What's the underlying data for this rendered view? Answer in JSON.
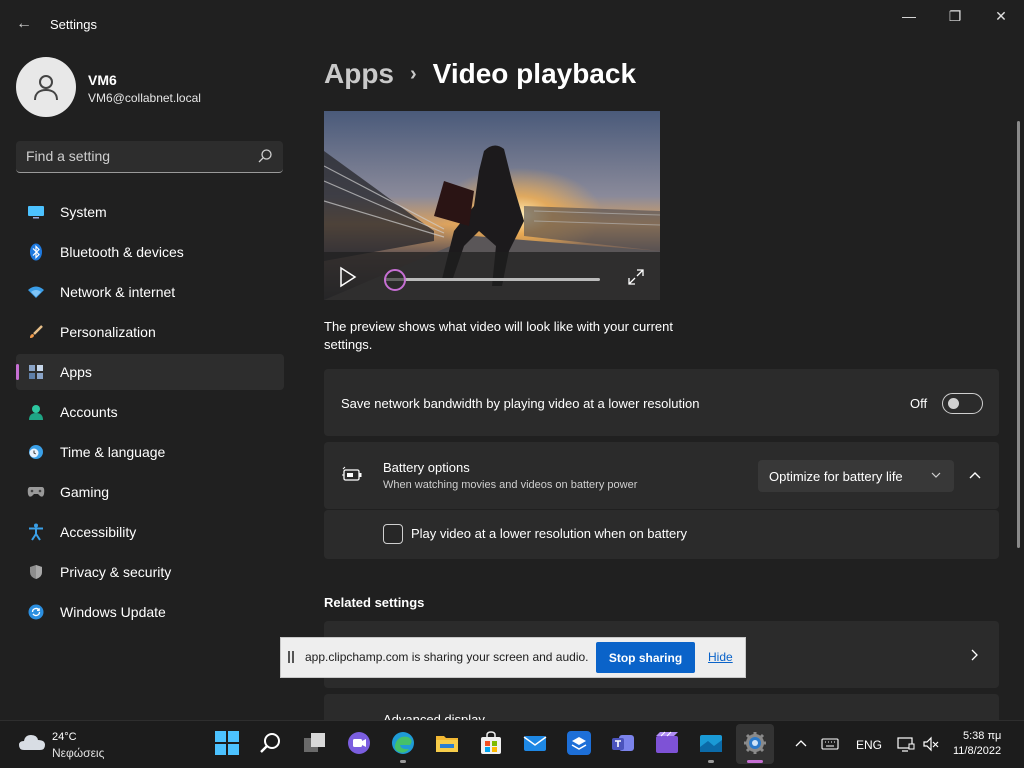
{
  "window": {
    "back_glyph": "←",
    "title": "Settings",
    "minimize_glyph": "—",
    "maximize_glyph": "❐",
    "close_glyph": "✕"
  },
  "profile": {
    "name": "VM6",
    "email": "VM6@collabnet.local"
  },
  "search": {
    "placeholder": "Find a setting"
  },
  "sidebar": {
    "items": [
      {
        "label": "System",
        "icon": "monitor-icon"
      },
      {
        "label": "Bluetooth & devices",
        "icon": "bluetooth-icon"
      },
      {
        "label": "Network & internet",
        "icon": "wifi-icon"
      },
      {
        "label": "Personalization",
        "icon": "brush-icon"
      },
      {
        "label": "Apps",
        "icon": "apps-icon",
        "active": true
      },
      {
        "label": "Accounts",
        "icon": "person-icon"
      },
      {
        "label": "Time & language",
        "icon": "clock-globe-icon"
      },
      {
        "label": "Gaming",
        "icon": "gamepad-icon"
      },
      {
        "label": "Accessibility",
        "icon": "accessibility-icon"
      },
      {
        "label": "Privacy & security",
        "icon": "shield-icon"
      },
      {
        "label": "Windows Update",
        "icon": "refresh-icon"
      }
    ]
  },
  "main": {
    "breadcrumb_parent": "Apps",
    "breadcrumb_sep": "›",
    "page_title": "Video playback",
    "video": {
      "seek_position": 0
    },
    "preview_description": "The preview shows what video will look like with your current settings.",
    "bandwidth": {
      "label": "Save network bandwidth by playing video at a lower resolution",
      "state": "Off",
      "on": false
    },
    "battery": {
      "title": "Battery options",
      "description": "When watching movies and videos on battery power",
      "selected": "Optimize for battery life",
      "checkbox_label": "Play video at a lower resolution when on battery",
      "checkbox_checked": false
    },
    "related_heading": "Related settings",
    "related_item2": "Advanced display"
  },
  "share_banner": {
    "text": "app.clipchamp.com is sharing your screen and audio.",
    "stop_label": "Stop sharing",
    "hide_label": "Hide"
  },
  "taskbar": {
    "weather_temp": "24°C",
    "weather_condition": "Νεφώσεις",
    "language": "ENG",
    "time": "5:38 πμ",
    "date": "11/8/2022"
  },
  "colors": {
    "accent": "#c66fd3",
    "background": "#202020",
    "card": "#2b2b2b",
    "share_button": "#0a63c9"
  }
}
